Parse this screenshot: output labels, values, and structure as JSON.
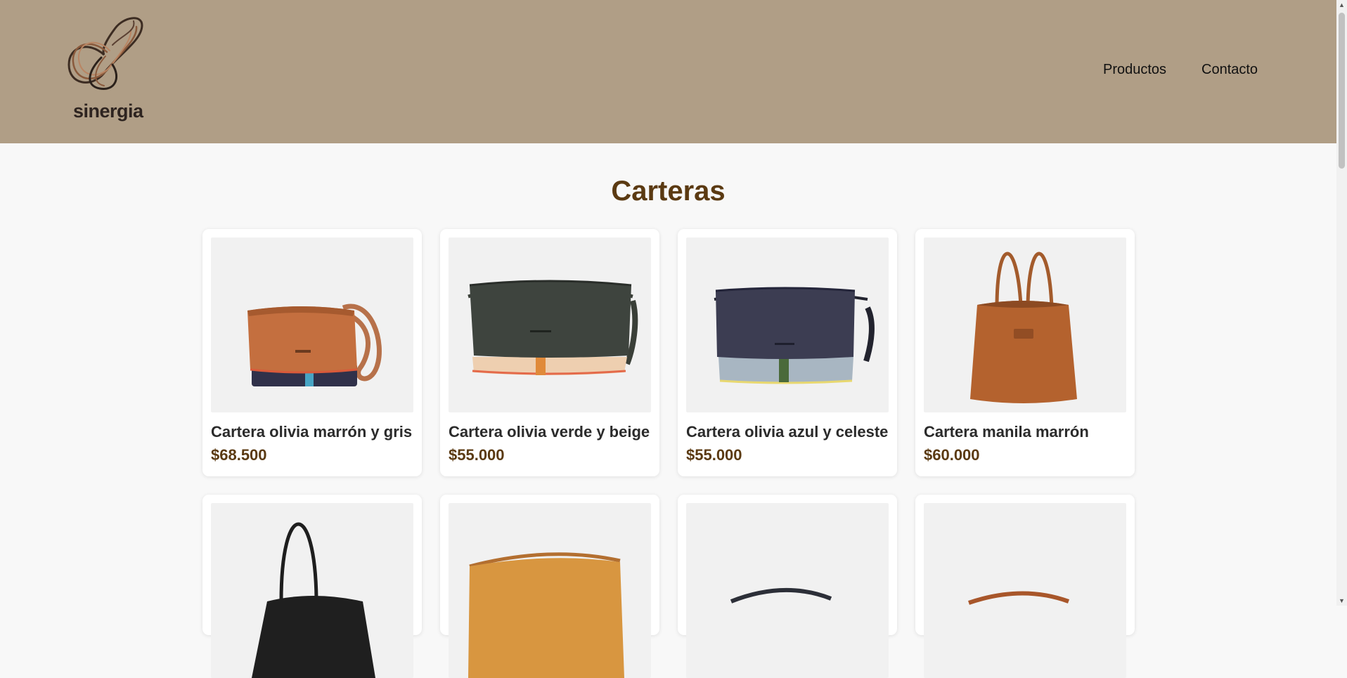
{
  "brand": {
    "name": "sinergia"
  },
  "nav": [
    {
      "label": "Productos"
    },
    {
      "label": "Contacto"
    }
  ],
  "page_title": "Carteras",
  "products": [
    {
      "name": "Cartera olivia marrón y gris",
      "price": "$68.500"
    },
    {
      "name": "Cartera olivia verde y beige",
      "price": "$55.000"
    },
    {
      "name": "Cartera olivia azul y celeste",
      "price": "$55.000"
    },
    {
      "name": "Cartera manila marrón",
      "price": "$60.000"
    }
  ],
  "colors": {
    "header_bg": "#b09e86",
    "accent_brown": "#5b3a12",
    "page_bg": "#f8f8f8"
  }
}
